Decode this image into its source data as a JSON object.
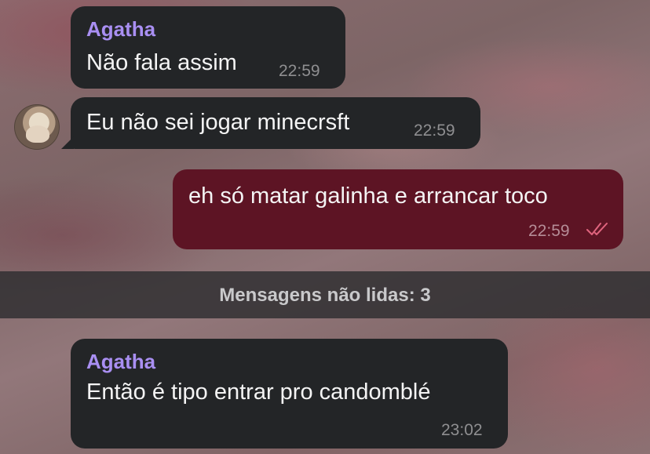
{
  "messages": [
    {
      "sender": "Agatha",
      "text": "Não fala assim",
      "time": "22:59",
      "direction": "incoming"
    },
    {
      "text": "Eu não sei jogar minecrsft",
      "time": "22:59",
      "direction": "incoming"
    },
    {
      "text": "eh só matar galinha e arrancar toco",
      "time": "22:59",
      "direction": "outgoing",
      "status": "read"
    },
    {
      "sender": "Agatha",
      "text": "Então é tipo entrar pro candomblé",
      "time": "23:02",
      "direction": "incoming"
    }
  ],
  "unread_divider": {
    "label": "Mensagens não lidas: 3"
  },
  "icons": {
    "read_receipt": "double-check-icon",
    "avatar": "contact-avatar"
  },
  "colors": {
    "incoming_bubble": "#232527",
    "outgoing_bubble": "#5d1424",
    "sender_name": "#a98ff2",
    "read_check": "#e0647e"
  }
}
